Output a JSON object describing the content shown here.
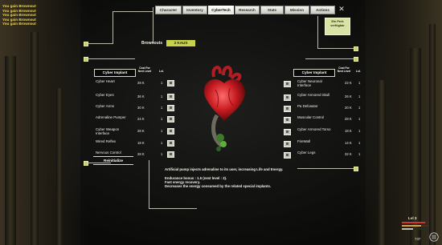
{
  "log": [
    "You gain Brownout",
    "You gain Brownout",
    "You gain Brownout",
    "You gain Brownout",
    "You gain Brownout"
  ],
  "tabs": [
    "Character",
    "Inventory",
    "CyberTech",
    "Research",
    "Stats",
    "Mission",
    "Actions"
  ],
  "active_tab": "CyberTech",
  "perk": {
    "line1": "Ein Perk",
    "line2": "verfügbar"
  },
  "brownouts": {
    "label": "Brownouts",
    "value": "2 KAUS"
  },
  "left_table": {
    "header": "Cyber Implant",
    "cost_header": "Cost For Next Level",
    "lvl_header": "Lvl.",
    "rows": [
      {
        "name": "Cyber Heart",
        "cost": "28 K",
        "lvl": "1"
      },
      {
        "name": "Cyber Eyes",
        "cost": "36 K",
        "lvl": "1"
      },
      {
        "name": "Cyber Arms",
        "cost": "30 K",
        "lvl": "1"
      },
      {
        "name": "Adrenaline Pumper",
        "cost": "24 K",
        "lvl": "1"
      },
      {
        "name": "Cyber Weapon Interface",
        "cost": "28 K",
        "lvl": "1"
      },
      {
        "name": "Wired Reflex",
        "cost": "18 K",
        "lvl": "1"
      },
      {
        "name": "Nervous Control",
        "cost": "28 K",
        "lvl": "1"
      }
    ]
  },
  "right_table": {
    "header": "Cyber Implant",
    "cost_header": "Cost For Next Level",
    "lvl_header": "Lvl.",
    "rows": [
      {
        "name": "Cyber Neuronal Interface",
        "cost": "22 K",
        "lvl": "1"
      },
      {
        "name": "Cyber Armored Skull",
        "cost": "26 K",
        "lvl": "1"
      },
      {
        "name": "Pa Defusator",
        "cost": "20 K",
        "lvl": "1"
      },
      {
        "name": "Muscular Control",
        "cost": "28 K",
        "lvl": "1"
      },
      {
        "name": "Cyber Armored Torso",
        "cost": "18 K",
        "lvl": "1"
      },
      {
        "name": "FireWall",
        "cost": "14 K",
        "lvl": "1"
      },
      {
        "name": "Cyber Legs",
        "cost": "32 K",
        "lvl": "1"
      }
    ]
  },
  "reinit_label": "Reinitialize",
  "description": [
    "Artificial pump injects adrenaline to its user, increasing Life and Energy.",
    "",
    "Endurance bonus : 1.5 (next level : 3).",
    "Fast energy recovery.",
    "Decreases the energy consumed by the related special implants."
  ],
  "hud": {
    "level_label": "Lvl 3",
    "counter": "737",
    "health_pct": 0.85,
    "energy_pct": 0.7,
    "xp_pct": 0.4
  },
  "colors": {
    "accent": "#c8d14a",
    "log": "#f1d74a",
    "health": "#d2362b",
    "energy": "#d8a03a"
  }
}
